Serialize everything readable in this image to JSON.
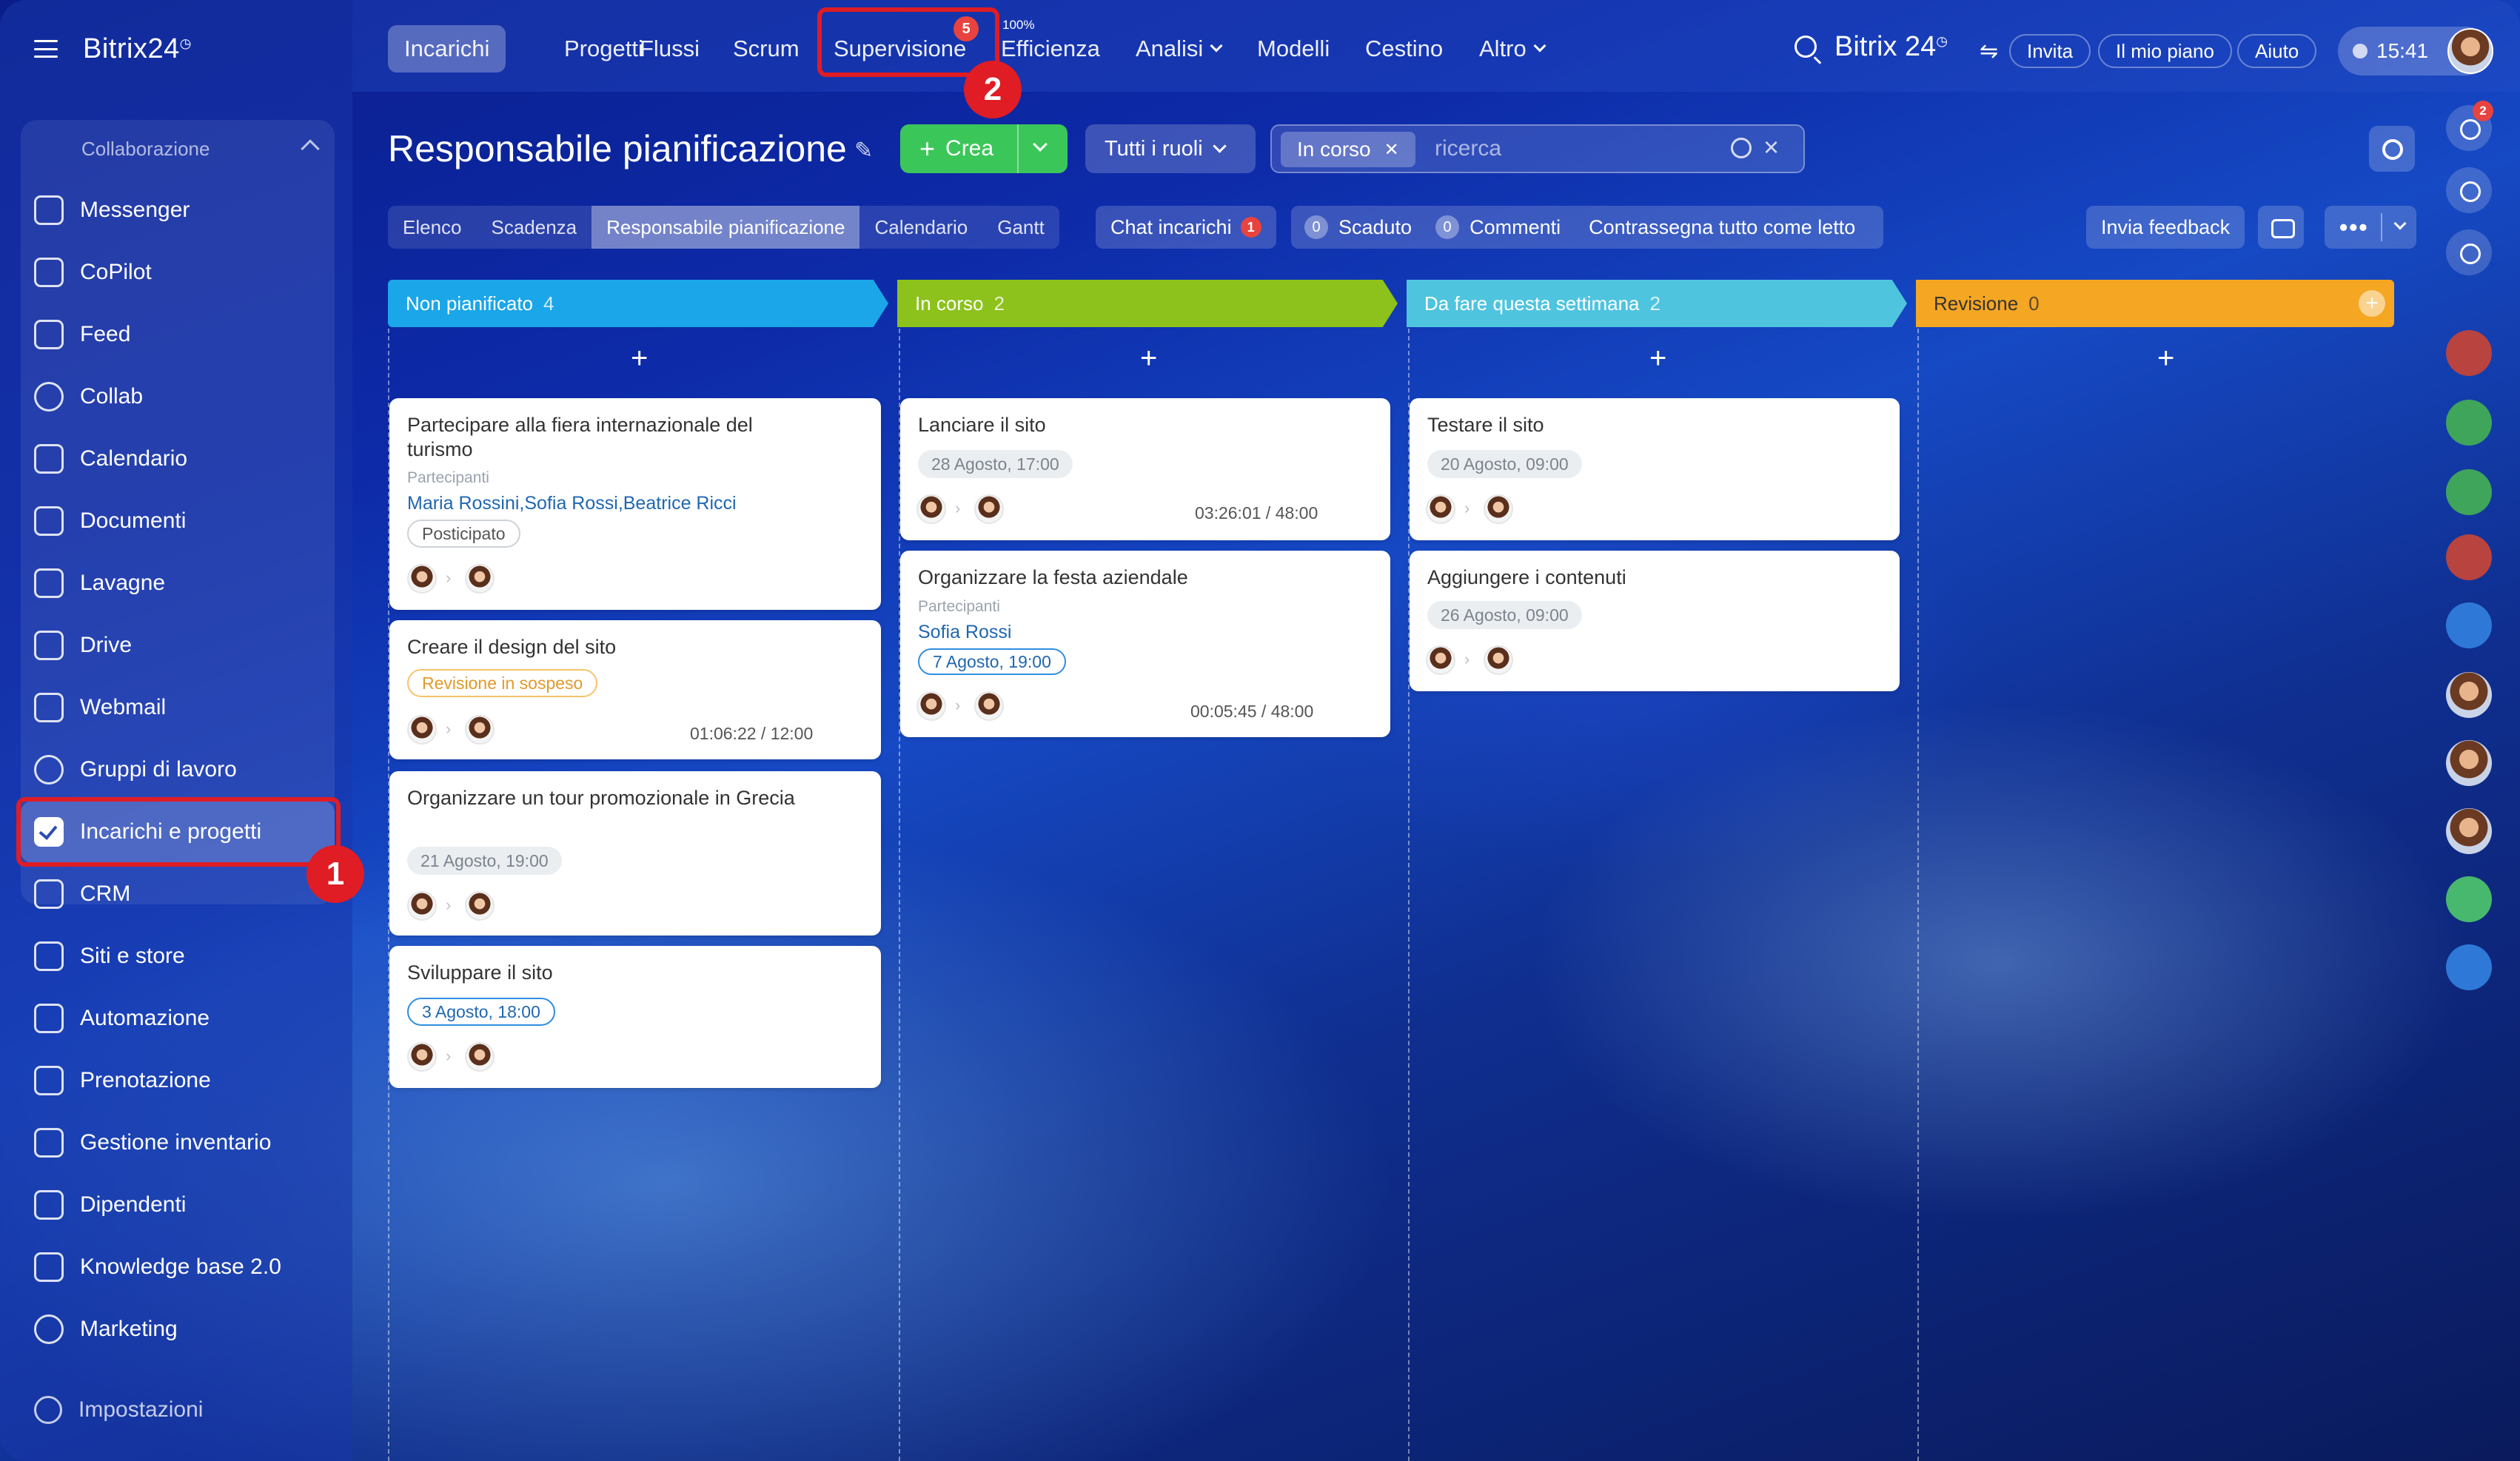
{
  "sidebar": {
    "logo": "Bitrix24",
    "section_title": "Collaborazione",
    "items": [
      {
        "label": "Messenger",
        "icon": "messenger-icon"
      },
      {
        "label": "CoPilot",
        "icon": "copilot-icon"
      },
      {
        "label": "Feed",
        "icon": "feed-icon"
      },
      {
        "label": "Collab",
        "icon": "collab-icon"
      },
      {
        "label": "Calendario",
        "icon": "calendar-icon"
      },
      {
        "label": "Documenti",
        "icon": "documents-icon"
      },
      {
        "label": "Lavagne",
        "icon": "boards-icon"
      },
      {
        "label": "Drive",
        "icon": "drive-icon"
      },
      {
        "label": "Webmail",
        "icon": "mail-icon"
      },
      {
        "label": "Gruppi di lavoro",
        "icon": "groups-icon"
      },
      {
        "label": "Incarichi e progetti",
        "icon": "tasks-icon",
        "active": true
      },
      {
        "label": "CRM",
        "icon": "crm-icon"
      },
      {
        "label": "Siti e store",
        "icon": "cart-icon"
      },
      {
        "label": "Automazione",
        "icon": "robot-icon"
      },
      {
        "label": "Prenotazione",
        "icon": "booking-icon"
      },
      {
        "label": "Gestione inventario",
        "icon": "inventory-icon"
      },
      {
        "label": "Dipendenti",
        "icon": "employees-icon"
      },
      {
        "label": "Knowledge base 2.0",
        "icon": "library-icon"
      },
      {
        "label": "Marketing",
        "icon": "marketing-icon"
      }
    ],
    "settings_label": "Impostazioni"
  },
  "annotations": {
    "marker1": "1",
    "marker2": "2",
    "color": "#e01c24"
  },
  "topbar": {
    "tabs": [
      "Incarichi",
      "Progetti",
      "Flussi",
      "Scrum",
      "Supervisione",
      "Efficienza",
      "Analisi",
      "Modelli",
      "Cestino",
      "Altro"
    ],
    "supervision_badge": "5",
    "efficiency_pct": "100%",
    "brand": "Bitrix 24",
    "invite": "Invita",
    "plan": "Il mio piano",
    "help": "Aiuto",
    "time": "15:41"
  },
  "toolbar": {
    "title": "Responsabile pianificazione",
    "create": "Crea",
    "roles": "Tutti i ruoli",
    "filter_chip": "In corso",
    "search_placeholder": "ricerca"
  },
  "views": {
    "tabs": [
      "Elenco",
      "Scadenza",
      "Responsabile pianificazione",
      "Calendario",
      "Gantt"
    ],
    "chat": "Chat incarichi",
    "chat_badge": "1",
    "overdue_count": "0",
    "overdue": "Scaduto",
    "comments_count": "0",
    "comments": "Commenti",
    "mark_read": "Contrassegna tutto come letto",
    "feedback": "Invia feedback"
  },
  "columns": [
    {
      "name": "Non pianificato",
      "count": "4",
      "color": "#1aa6e8"
    },
    {
      "name": "In corso",
      "count": "2",
      "color": "#8cc21b"
    },
    {
      "name": "Da fare questa settimana",
      "count": "2",
      "color": "#4fc4df"
    },
    {
      "name": "Revisione",
      "count": "0",
      "color": "#f5a623"
    }
  ],
  "cards": {
    "c1": {
      "title": "Partecipare alla fiera internazionale del turismo",
      "label": "Partecipanti",
      "who": "Maria Rossini,Sofia Rossi,Beatrice Ricci",
      "tag": "Posticipato"
    },
    "c2": {
      "title": "Creare il design del sito",
      "tag": "Revisione in sospeso",
      "time": "01:06:22 / 12:00"
    },
    "c3": {
      "title": "Organizzare un tour promozionale in Grecia",
      "tag": "21 Agosto, 19:00"
    },
    "c4": {
      "title": "Sviluppare il sito",
      "tag": "3 Agosto, 18:00"
    },
    "c5": {
      "title": "Lanciare il sito",
      "tag": "28 Agosto, 17:00",
      "time": "03:26:01 / 48:00"
    },
    "c6": {
      "title": "Organizzare la festa aziendale",
      "label": "Partecipanti",
      "who": "Sofia Rossi",
      "tag": "7 Agosto, 19:00",
      "time": "00:05:45 / 48:00"
    },
    "c7": {
      "title": "Testare il sito",
      "tag": "20 Agosto, 09:00"
    },
    "c8": {
      "title": "Aggiungere i contenuti",
      "tag": "26 Agosto, 09:00"
    }
  },
  "rightbar": {
    "bell_badge": "2"
  }
}
